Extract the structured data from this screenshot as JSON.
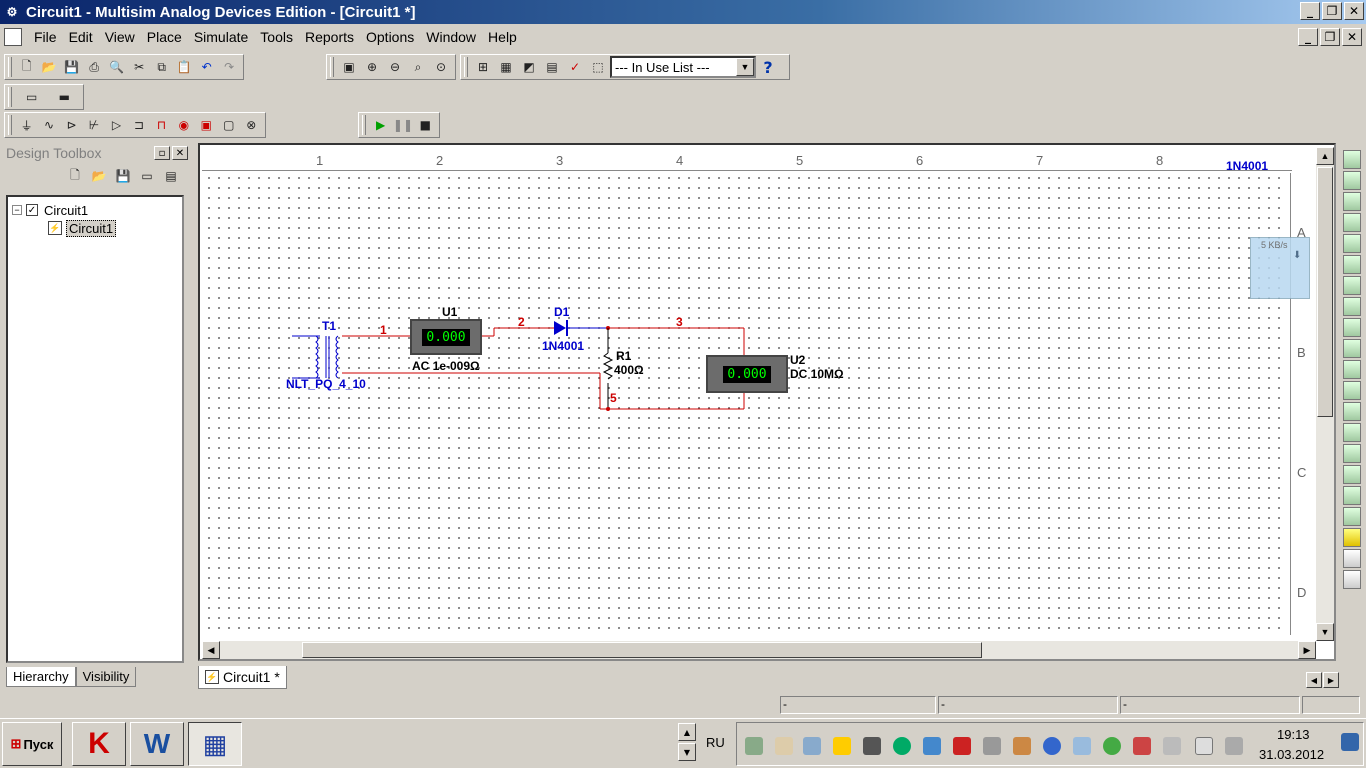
{
  "window": {
    "title": "Circuit1 - Multisim Analog Devices Edition - [Circuit1 *]"
  },
  "menu": [
    "File",
    "Edit",
    "View",
    "Place",
    "Simulate",
    "Tools",
    "Reports",
    "Options",
    "Window",
    "Help"
  ],
  "toolbar": {
    "in_use_list": "--- In Use List ---",
    "help": "?"
  },
  "toolbox": {
    "title": "Design Toolbox",
    "tree": {
      "root": "Circuit1",
      "child": "Circuit1"
    },
    "tabs": [
      "Hierarchy",
      "Visibility"
    ]
  },
  "ruler": {
    "columns": [
      "1",
      "2",
      "3",
      "4",
      "5",
      "6",
      "7",
      "8"
    ],
    "rows": [
      "A",
      "B",
      "C",
      "D"
    ],
    "corner_label": "1N4001"
  },
  "overlay": {
    "rate": "5 KB/s"
  },
  "schematic": {
    "t1": {
      "ref": "T1",
      "model": "NLT_PQ_4_10"
    },
    "u1": {
      "ref": "U1",
      "reading": "0.000",
      "mode": "AC  1e-009Ω"
    },
    "d1": {
      "ref": "D1",
      "model": "1N4001"
    },
    "r1": {
      "ref": "R1",
      "value": "400Ω"
    },
    "u2": {
      "ref": "U2",
      "reading": "0.000",
      "mode": "DC  10MΩ"
    },
    "nets": [
      "1",
      "2",
      "3",
      "5"
    ]
  },
  "doc_tab": "Circuit1 *",
  "taskbar": {
    "start": "Пуск",
    "lang": "RU",
    "time": "19:13",
    "date": "31.03.2012"
  },
  "colors": {
    "wire": "#cc0000",
    "label_blue": "#0000cc",
    "meter_text": "#00ff00",
    "titlebar": "#0a246a"
  }
}
